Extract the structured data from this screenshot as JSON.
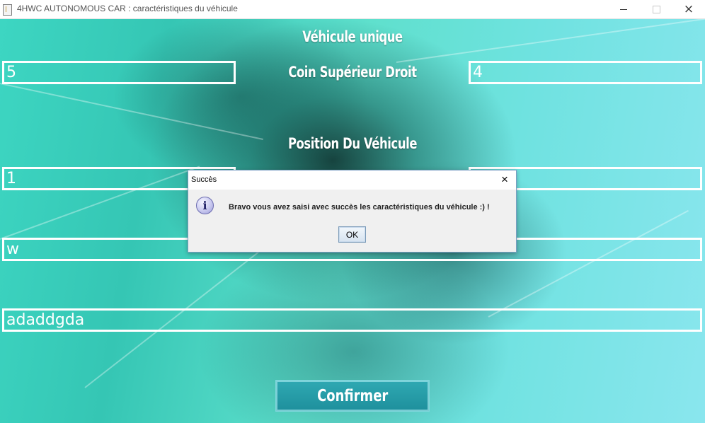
{
  "window": {
    "title": "4HWC AUTONOMOUS CAR : caractéristiques du véhicule",
    "icon": "java-app-icon",
    "controls": {
      "minimize": "minimize-icon",
      "maximize": "maximize-icon",
      "close": "×"
    }
  },
  "form": {
    "heading_vehicle": "Véhicule unique",
    "heading_corner": "Coin Supérieur Droit",
    "heading_position": "Position Du Véhicule",
    "corner_x_value": "5",
    "corner_y_value": "4",
    "position_x_value": "1",
    "position_y_value": "",
    "orientation_value": "w",
    "instructions_value": "adaddgda",
    "confirm_label": "Confirmer"
  },
  "dialog": {
    "title": "Succès",
    "close": "×",
    "icon": "i",
    "message": "Bravo vous avez saisi avec succès les caractéristiques du véhicule :) !",
    "ok_label": "OK"
  },
  "colors": {
    "accent": "#1e8f9c",
    "background": "#3dd6c2",
    "field_border": "#ffffff"
  }
}
